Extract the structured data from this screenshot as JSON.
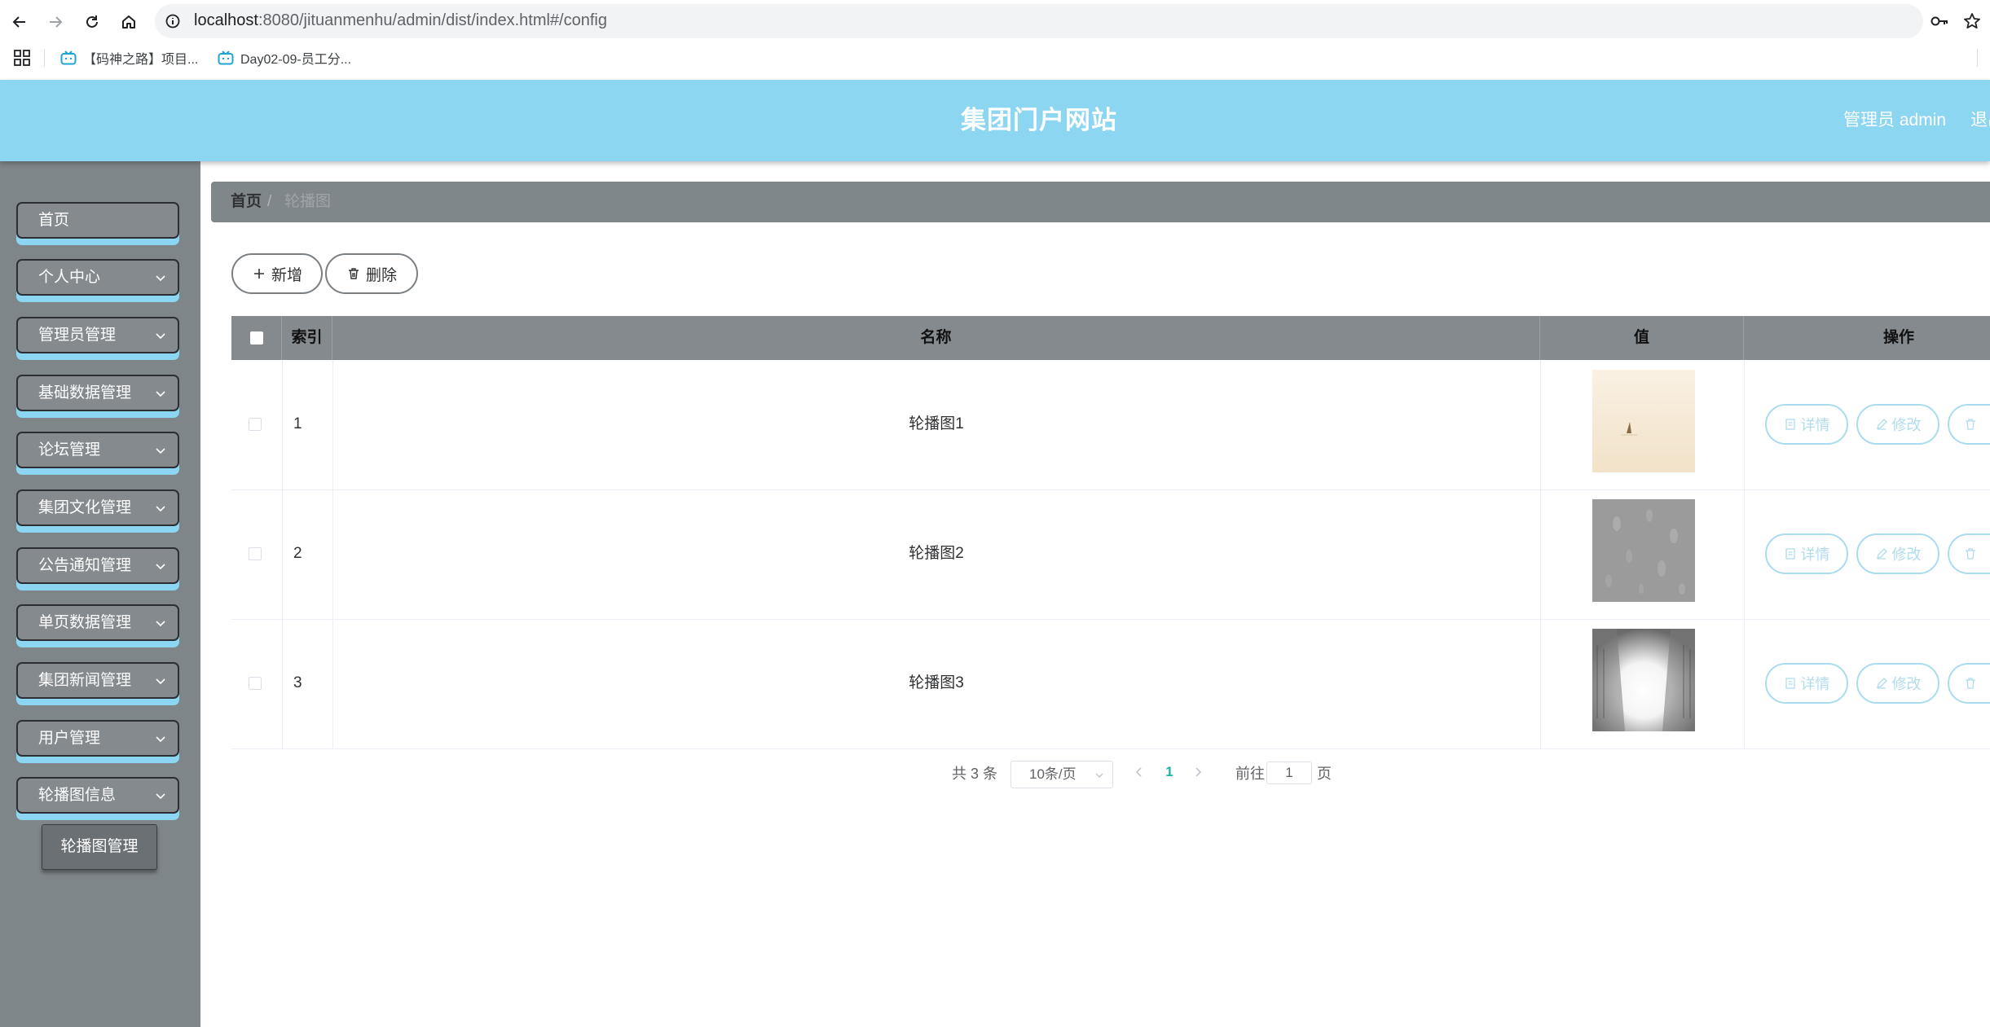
{
  "browser": {
    "url_host": "localhost",
    "url_rest": ":8080/jituanmenhu/admin/dist/index.html#/config",
    "bookmarks": [
      {
        "label": "【码神之路】项目..."
      },
      {
        "label": "Day02-09-员工分..."
      }
    ],
    "icons": [
      "back-icon",
      "forward-icon",
      "reload-icon",
      "home-icon",
      "site-info-icon",
      "password-key-icon",
      "bookmark-star-icon",
      "apps-grid-icon"
    ]
  },
  "header": {
    "title": "集团门户网站",
    "user": "管理员 admin",
    "logout": "退出"
  },
  "sidebar": {
    "items": [
      {
        "label": "首页",
        "expandable": false
      },
      {
        "label": "个人中心",
        "expandable": true
      },
      {
        "label": "管理员管理",
        "expandable": true
      },
      {
        "label": "基础数据管理",
        "expandable": true
      },
      {
        "label": "论坛管理",
        "expandable": true
      },
      {
        "label": "集团文化管理",
        "expandable": true
      },
      {
        "label": "公告通知管理",
        "expandable": true
      },
      {
        "label": "单页数据管理",
        "expandable": true
      },
      {
        "label": "集团新闻管理",
        "expandable": true
      },
      {
        "label": "用户管理",
        "expandable": true
      },
      {
        "label": "轮播图信息",
        "expandable": true
      }
    ],
    "submenu": {
      "label": "轮播图管理"
    }
  },
  "breadcrumb": {
    "home": "首页",
    "separator": "/",
    "current": "轮播图"
  },
  "toolbar": {
    "add_label": "新增",
    "delete_label": "删除"
  },
  "table": {
    "headers": {
      "index": "索引",
      "name": "名称",
      "value": "值",
      "actions": "操作"
    },
    "rows": [
      {
        "index": "1",
        "name": "轮播图1",
        "image": "cream-desert-sailboat"
      },
      {
        "index": "2",
        "name": "轮播图2",
        "image": "grey-rain-texture"
      },
      {
        "index": "3",
        "name": "轮播图3",
        "image": "grey-city-street"
      }
    ],
    "actions": {
      "detail": "详情",
      "edit": "修改",
      "delete": "删除"
    }
  },
  "pagination": {
    "total": "共 3 条",
    "page_size": "10条/页",
    "current_page": "1",
    "goto_prefix": "前往",
    "goto_value": "1",
    "goto_suffix": "页"
  },
  "colors": {
    "header_bg": "#8dd6f1",
    "sidebar_bg": "#7f868a",
    "accent_border": "#a9dcee",
    "active_page": "#1fb19e"
  }
}
